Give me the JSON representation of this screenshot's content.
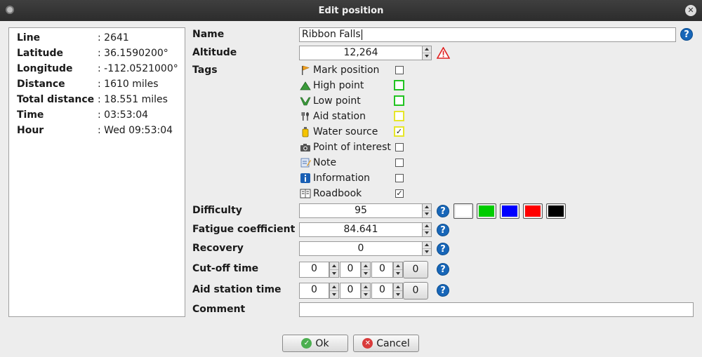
{
  "window": {
    "title": "Edit position"
  },
  "info": {
    "rows": [
      {
        "label": "Line",
        "value": ": 2641"
      },
      {
        "label": "Latitude",
        "value": ": 36.1590200°"
      },
      {
        "label": "Longitude",
        "value": ": -112.0521000°"
      },
      {
        "label": "Distance",
        "value": ": 1610 miles"
      },
      {
        "label": "Total distance",
        "value": ": 18.551 miles"
      },
      {
        "label": "Time",
        "value": ": 03:53:04"
      },
      {
        "label": "Hour",
        "value": ": Wed 09:53:04"
      }
    ]
  },
  "form": {
    "name_label": "Name",
    "name_value": "Ribbon Falls",
    "altitude_label": "Altitude",
    "altitude_value": "12,264",
    "tags_label": "Tags",
    "tags": [
      {
        "label": "Mark position",
        "icon": "flag-icon",
        "checked": false,
        "highlight": ""
      },
      {
        "label": "High point",
        "icon": "mountain-icon",
        "checked": false,
        "highlight": "#22c322"
      },
      {
        "label": "Low point",
        "icon": "valley-icon",
        "checked": false,
        "highlight": "#22c322"
      },
      {
        "label": "Aid station",
        "icon": "cutlery-icon",
        "checked": false,
        "highlight": "#e6e62a"
      },
      {
        "label": "Water source",
        "icon": "water-bottle-icon",
        "checked": true,
        "highlight": "#e6e62a"
      },
      {
        "label": "Point of interest",
        "icon": "camera-icon",
        "checked": false,
        "highlight": ""
      },
      {
        "label": "Note",
        "icon": "note-icon",
        "checked": false,
        "highlight": ""
      },
      {
        "label": "Information",
        "icon": "info-icon",
        "checked": false,
        "highlight": ""
      },
      {
        "label": "Roadbook",
        "icon": "roadbook-icon",
        "checked": true,
        "highlight": ""
      }
    ],
    "difficulty_label": "Difficulty",
    "difficulty_value": "95",
    "difficulty_colors": [
      "#ffffff",
      "#00cc00",
      "#0000ff",
      "#ff0000",
      "#000000"
    ],
    "fatigue_label": "Fatigue coefficient",
    "fatigue_value": "84.641",
    "recovery_label": "Recovery",
    "recovery_value": "0",
    "cutoff_label": "Cut-off time",
    "cutoff_values": [
      "0",
      "0",
      "0"
    ],
    "cutoff_reset": "0",
    "aidtime_label": "Aid station time",
    "aidtime_values": [
      "0",
      "0",
      "0"
    ],
    "aidtime_reset": "0",
    "comment_label": "Comment",
    "comment_value": ""
  },
  "buttons": {
    "ok": "Ok",
    "cancel": "Cancel"
  },
  "colors": {
    "help": "#1766b8",
    "warning": "#e02020"
  }
}
